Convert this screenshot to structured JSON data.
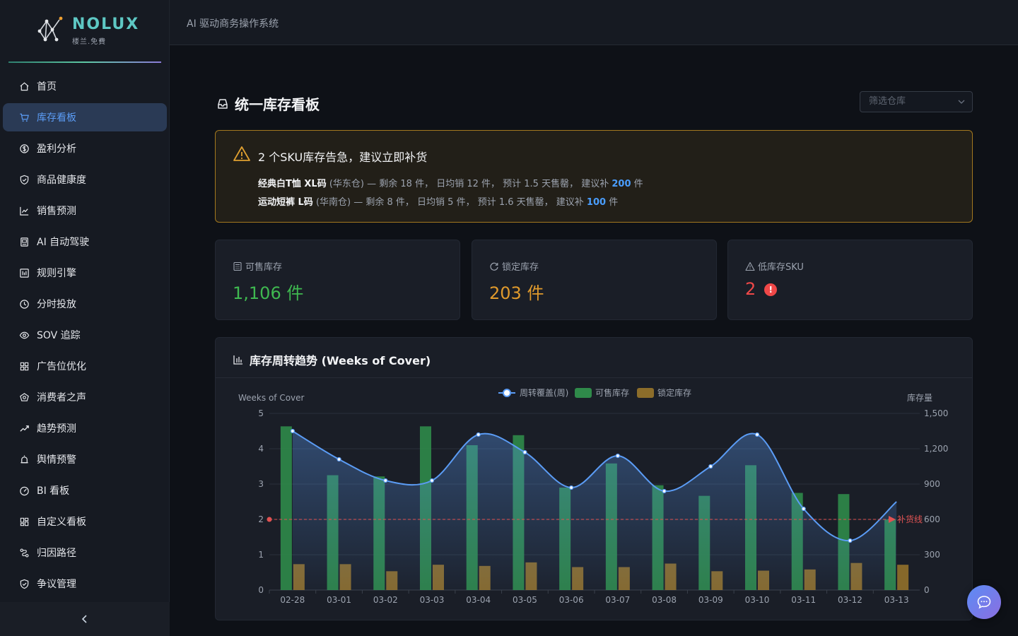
{
  "brand": {
    "name": "NOLUX",
    "sub": "楼兰.免費"
  },
  "header": {
    "title": "AI 驱动商务操作系统"
  },
  "sidebar": {
    "items": [
      {
        "label": "首页",
        "icon": "home-icon"
      },
      {
        "label": "库存看板",
        "icon": "cart-icon",
        "active": true
      },
      {
        "label": "盈利分析",
        "icon": "dollar-icon"
      },
      {
        "label": "商品健康度",
        "icon": "shield-check-icon"
      },
      {
        "label": "销售预测",
        "icon": "line-chart-icon"
      },
      {
        "label": "AI 自动驾驶",
        "icon": "robot-icon"
      },
      {
        "label": "规则引擎",
        "icon": "rules-icon"
      },
      {
        "label": "分时投放",
        "icon": "clock-icon"
      },
      {
        "label": "SOV 追踪",
        "icon": "eye-icon"
      },
      {
        "label": "广告位优化",
        "icon": "grid-icon"
      },
      {
        "label": "消费者之声",
        "icon": "voice-icon"
      },
      {
        "label": "趋势预测",
        "icon": "trend-icon"
      },
      {
        "label": "舆情预警",
        "icon": "alarm-icon"
      },
      {
        "label": "BI 看板",
        "icon": "dashboard-icon"
      },
      {
        "label": "自定义看板",
        "icon": "custom-board-icon"
      },
      {
        "label": "归因路径",
        "icon": "path-icon"
      },
      {
        "label": "争议管理",
        "icon": "shield-icon"
      }
    ]
  },
  "page": {
    "title": "统一库存看板",
    "warehouse_placeholder": "筛选仓库"
  },
  "alert": {
    "title": "2 个SKU库存告急，建议立即补货",
    "rows": [
      {
        "sku": "经典白T恤 XL码",
        "wh": "(华东仓)",
        "detail": " — 剩余 18 件， 日均销 12 件， 预计 1.5 天售罄， 建议补 ",
        "qty": "200",
        "unit": " 件"
      },
      {
        "sku": "运动短裤 L码",
        "wh": "(华南仓)",
        "detail": " — 剩余 8 件， 日均销 5 件， 预计 1.6 天售罄， 建议补 ",
        "qty": "100",
        "unit": " 件"
      }
    ]
  },
  "stats": [
    {
      "label": "可售库存",
      "value": "1,106 件",
      "color": "#3fb950"
    },
    {
      "label": "锁定库存",
      "value": "203 件",
      "color": "#e09a2c"
    },
    {
      "label": "低库存SKU",
      "value": "2",
      "color": "#f04848",
      "badge": "!"
    }
  ],
  "chart": {
    "title": "库存周转趋势 (Weeks of Cover)"
  },
  "chart_data": {
    "type": "bar",
    "categories": [
      "02-28",
      "03-01",
      "03-02",
      "03-03",
      "03-04",
      "03-05",
      "03-06",
      "03-07",
      "03-08",
      "03-09",
      "03-10",
      "03-11",
      "03-12",
      "03-13"
    ],
    "series": [
      {
        "name": "周转覆盖(周)",
        "type": "line",
        "axis": "left",
        "color": "#5b9cf5",
        "values": [
          4.5,
          3.7,
          3.1,
          3.1,
          4.4,
          3.9,
          2.9,
          3.8,
          2.8,
          3.5,
          4.4,
          2.3,
          1.4,
          2.5
        ]
      },
      {
        "name": "可售库存",
        "type": "bar",
        "axis": "right",
        "color": "#2f8a4a",
        "values": [
          1390,
          975,
          965,
          1390,
          1230,
          1315,
          870,
          1075,
          890,
          800,
          1060,
          825,
          815,
          600
        ]
      },
      {
        "name": "锁定库存",
        "type": "bar",
        "axis": "right",
        "color": "#8c6d2a",
        "values": [
          220,
          220,
          160,
          215,
          205,
          235,
          195,
          195,
          225,
          160,
          165,
          175,
          230,
          215
        ]
      }
    ],
    "ylabel": "Weeks of Cover",
    "y2label": "库存量",
    "ylim": [
      0,
      5
    ],
    "y2lim": [
      0,
      1500
    ],
    "yticks": [
      "0",
      "1",
      "2",
      "3",
      "4",
      "5"
    ],
    "y2ticks": [
      "0",
      "300",
      "600",
      "900",
      "1,200",
      "1,500"
    ],
    "markline": {
      "value": 2,
      "label": "补货线",
      "color": "#e05252"
    },
    "legend": "top-center",
    "grid": true
  }
}
